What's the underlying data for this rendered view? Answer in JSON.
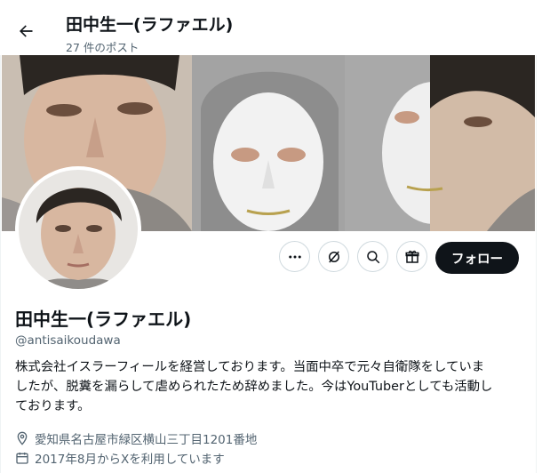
{
  "header": {
    "title": "田中生一(ラファエル)",
    "post_count": "27 件のポスト"
  },
  "profile": {
    "name": "田中生一(ラファエル)",
    "handle": "@antisaikoudawa",
    "bio_lines": [
      "株式会社イスラーフィールを経営しております。当面中卒で元々自衛隊をしていま",
      "したが、脱糞を漏らして虐められたため辞めました。今はYouTuberとしても活動し",
      "ております。"
    ],
    "location": "愛知県名古屋市緑区横山三丁目1201番地",
    "joined": "2017年8月からXを利用しています"
  },
  "actions": {
    "more_icon": "more-icon",
    "grok_icon": "grok-icon",
    "search_icon": "search-icon",
    "gift_icon": "gift-icon",
    "follow_label": "フォロー"
  },
  "colors": {
    "text": "#0f1419",
    "secondary": "#536471",
    "follow_bg": "#0f1419",
    "border": "#cfd9de"
  }
}
